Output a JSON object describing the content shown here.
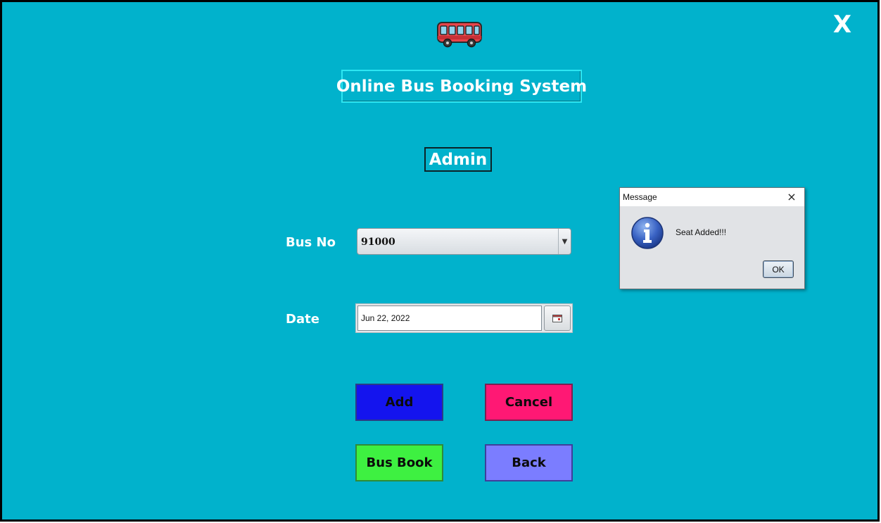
{
  "window": {
    "close_label": "X"
  },
  "header": {
    "title": "Online Bus Booking System",
    "subtitle": "Admin"
  },
  "form": {
    "bus_no_label": "Bus No",
    "bus_no_value": "91000",
    "date_label": "Date",
    "date_value": "Jun 22, 2022"
  },
  "buttons": {
    "add": "Add",
    "cancel": "Cancel",
    "bus_book": "Bus Book",
    "back": "Back"
  },
  "dialog": {
    "title": "Message",
    "close": "×",
    "message": "Seat Added!!!",
    "ok": "OK"
  },
  "colors": {
    "background": "#01b2cc",
    "add": "#1414ee",
    "cancel": "#ff1874",
    "bus_book": "#3ef041",
    "back": "#7b7dff"
  },
  "icons": [
    "bus-icon",
    "calendar-icon",
    "info-icon",
    "close-icon"
  ]
}
